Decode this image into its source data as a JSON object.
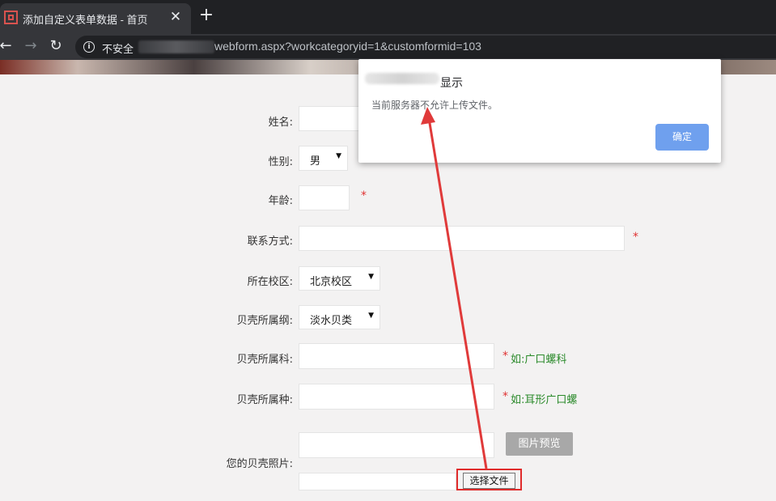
{
  "browser": {
    "tab_title": "添加自定义表单数据 - 首页",
    "close_glyph": "✕",
    "new_tab_glyph": "+",
    "back_glyph": "←",
    "forward_glyph": "→",
    "reload_glyph": "↻",
    "insecure_label": "不安全",
    "url_visible": "webform.aspx?workcategoryid=1&customformid=103"
  },
  "form": {
    "name_label": "姓名:",
    "gender_label": "性别:",
    "gender_value": "男",
    "age_label": "年龄:",
    "contact_label": "联系方式:",
    "campus_label": "所在校区:",
    "campus_value": "北京校区",
    "class_label": "贝壳所属纲:",
    "class_value": "淡水贝类",
    "family_label": "贝壳所属科:",
    "family_hint": "如:广口螺科",
    "species_label": "贝壳所属种:",
    "species_hint": "如:耳形广口螺",
    "photo_label": "您的贝壳照片:",
    "preview_button": "图片预览",
    "choose_file_button": "选择文件",
    "required_mark": "*",
    "dropdown_glyph": "▼"
  },
  "dialog": {
    "title_suffix": "显示",
    "message": "当前服务器不允许上传文件。",
    "ok_button": "确定"
  },
  "colors": {
    "annotation_red": "#e02b2b",
    "hint_green": "#2a8a2a",
    "ok_blue": "#6fa0ee"
  }
}
